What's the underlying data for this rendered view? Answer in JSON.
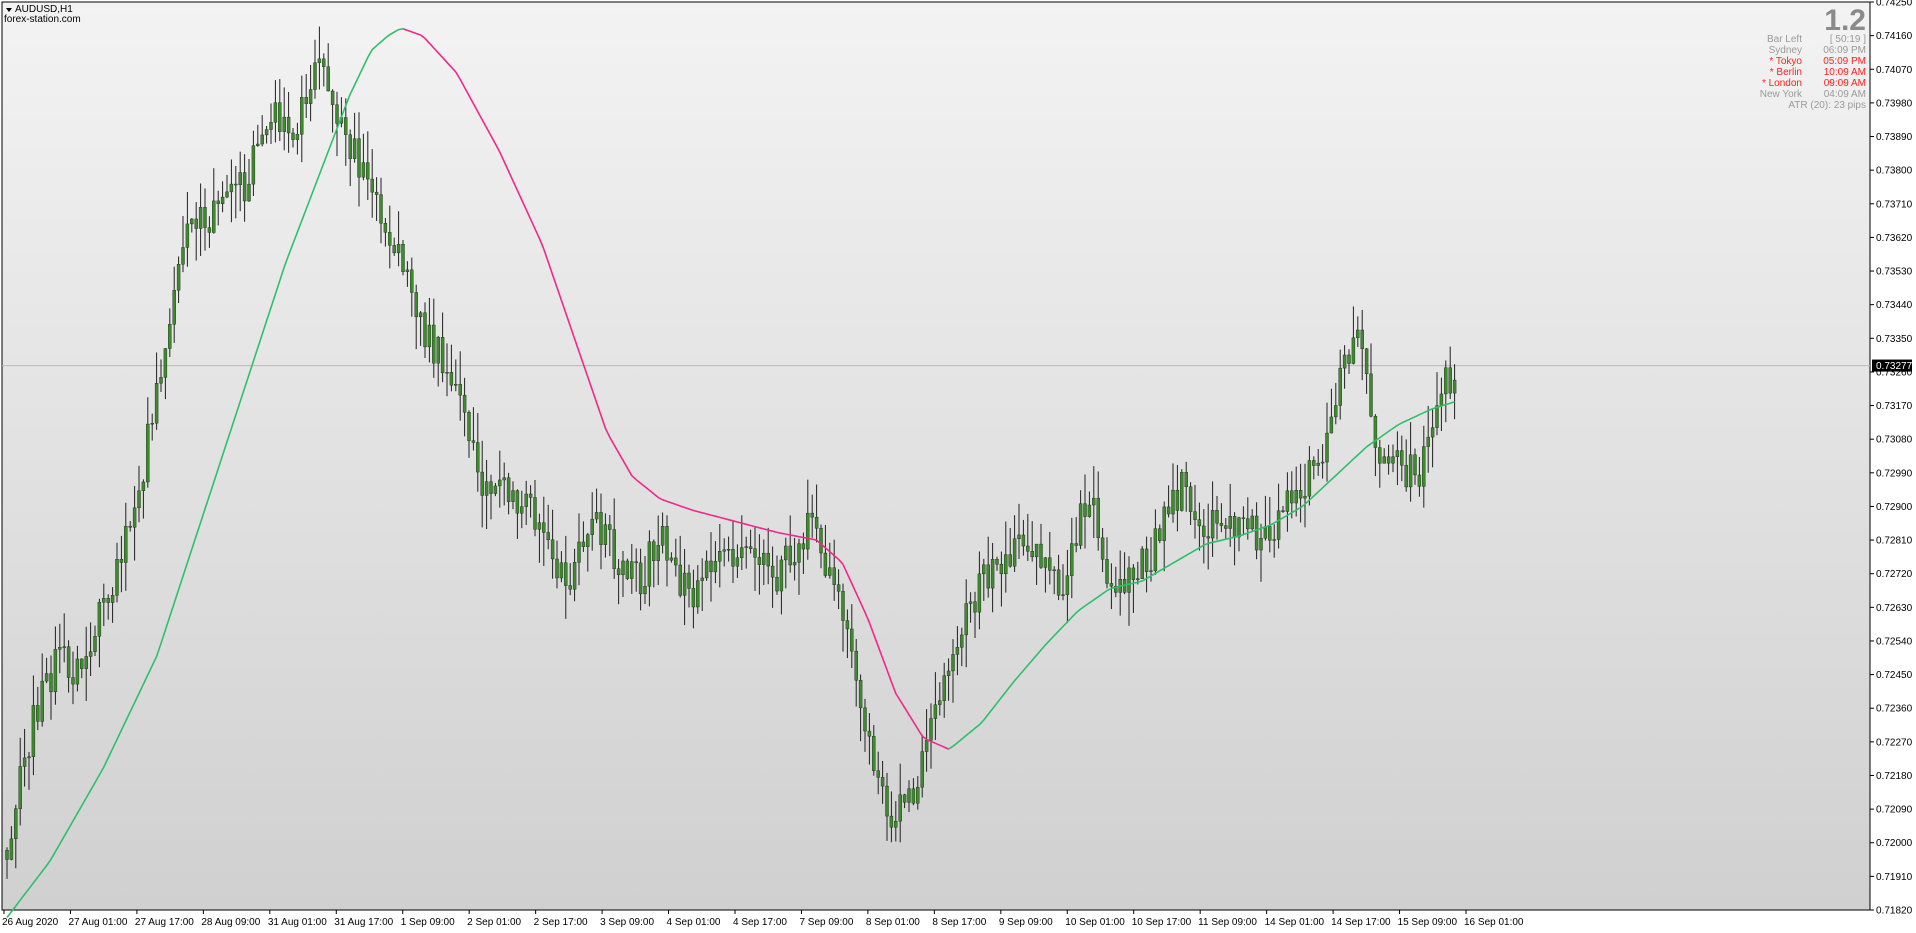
{
  "header": {
    "symbol_label": "AUDUSD,H1",
    "source_label": "forex-station.com",
    "big_value": "1.2"
  },
  "info_panel": [
    {
      "label": "Bar Left",
      "value": "[ 50:19 ]",
      "color": "#9a9a9a"
    },
    {
      "label": "Sydney",
      "value": "06:09 PM",
      "color": "#9a9a9a"
    },
    {
      "label": "* Tokyo",
      "value": "05:09 PM",
      "color": "#ff2020"
    },
    {
      "label": "* Berlin",
      "value": "10:09 AM",
      "color": "#ff2020"
    },
    {
      "label": "* London",
      "value": "09:09 AM",
      "color": "#ff2020"
    },
    {
      "label": "New York",
      "value": "04:09 AM",
      "color": "#9a9a9a"
    }
  ],
  "atr_text": "ATR (20): 23 pips",
  "colors": {
    "background_top": "#f3f3f3",
    "background_bottom": "#d0d0d0",
    "candle_body": "#3d8c2c",
    "candle_wick": "#202020",
    "ma_up": "#2fbf6a",
    "ma_down": "#f0288c",
    "price_tag_bg": "#000000",
    "current_price_line": "#b8b8b8"
  },
  "chart_data": {
    "type": "candlestick",
    "title": "AUDUSD,H1",
    "current_price": 0.73277,
    "current_price_label": "0.73277",
    "ylim": [
      0.7182,
      0.7425
    ],
    "y_ticks": [
      "0.74250",
      "0.74160",
      "0.74070",
      "0.73980",
      "0.73890",
      "0.73800",
      "0.73710",
      "0.73620",
      "0.73530",
      "0.73440",
      "0.73350",
      "0.73260",
      "0.73170",
      "0.73080",
      "0.72990",
      "0.72900",
      "0.72810",
      "0.72720",
      "0.72630",
      "0.72540",
      "0.72450",
      "0.72360",
      "0.72270",
      "0.72180",
      "0.72090",
      "0.72000",
      "0.71910",
      "0.71820"
    ],
    "x_tick_labels": [
      "26 Aug 2020",
      "27 Aug 01:00",
      "27 Aug 17:00",
      "28 Aug 09:00",
      "31 Aug 01:00",
      "31 Aug 17:00",
      "1 Sep 09:00",
      "2 Sep 01:00",
      "2 Sep 17:00",
      "3 Sep 09:00",
      "4 Sep 01:00",
      "4 Sep 17:00",
      "7 Sep 09:00",
      "8 Sep 01:00",
      "8 Sep 17:00",
      "9 Sep 09:00",
      "10 Sep 01:00",
      "10 Sep 17:00",
      "11 Sep 09:00",
      "14 Sep 01:00",
      "14 Sep 17:00",
      "15 Sep 09:00",
      "16 Sep 01:00"
    ],
    "bar_count": 330,
    "price_path": [
      [
        0,
        0.7198
      ],
      [
        12,
        0.7232
      ],
      [
        25,
        0.7252
      ],
      [
        32,
        0.7245
      ],
      [
        45,
        0.7262
      ],
      [
        60,
        0.729
      ],
      [
        70,
        0.732
      ],
      [
        82,
        0.736
      ],
      [
        98,
        0.737
      ],
      [
        110,
        0.7375
      ],
      [
        114,
        0.738
      ],
      [
        122,
        0.7396
      ],
      [
        132,
        0.7388
      ],
      [
        145,
        0.7408
      ],
      [
        165,
        0.738
      ],
      [
        180,
        0.7362
      ],
      [
        195,
        0.7336
      ],
      [
        210,
        0.7325
      ],
      [
        222,
        0.7295
      ],
      [
        235,
        0.7295
      ],
      [
        250,
        0.7285
      ],
      [
        262,
        0.7265
      ],
      [
        273,
        0.729
      ],
      [
        286,
        0.7273
      ],
      [
        297,
        0.727
      ],
      [
        305,
        0.7285
      ],
      [
        318,
        0.7265
      ],
      [
        332,
        0.7275
      ],
      [
        348,
        0.728
      ],
      [
        360,
        0.7272
      ],
      [
        375,
        0.7285
      ],
      [
        388,
        0.7265
      ],
      [
        400,
        0.7235
      ],
      [
        412,
        0.7205
      ],
      [
        425,
        0.7215
      ],
      [
        440,
        0.725
      ],
      [
        460,
        0.7275
      ],
      [
        478,
        0.728
      ],
      [
        492,
        0.7268
      ],
      [
        505,
        0.7293
      ],
      [
        516,
        0.7268
      ],
      [
        532,
        0.7275
      ],
      [
        548,
        0.7295
      ],
      [
        560,
        0.7285
      ],
      [
        575,
        0.7285
      ],
      [
        590,
        0.728
      ],
      [
        602,
        0.7295
      ],
      [
        614,
        0.7302
      ],
      [
        622,
        0.7325
      ],
      [
        630,
        0.7338
      ],
      [
        640,
        0.7305
      ],
      [
        650,
        0.73
      ],
      [
        660,
        0.7298
      ],
      [
        668,
        0.7318
      ],
      [
        676,
        0.7327
      ]
    ],
    "ma_path": [
      [
        0,
        0.718
      ],
      [
        20,
        0.7195
      ],
      [
        45,
        0.722
      ],
      [
        70,
        0.725
      ],
      [
        90,
        0.7285
      ],
      [
        110,
        0.732
      ],
      [
        130,
        0.7355
      ],
      [
        150,
        0.7385
      ],
      [
        160,
        0.74
      ],
      [
        170,
        0.7412
      ],
      [
        178,
        0.7416
      ],
      [
        184,
        0.7418
      ],
      [
        194,
        0.7416
      ],
      [
        210,
        0.7406
      ],
      [
        230,
        0.7385
      ],
      [
        250,
        0.736
      ],
      [
        265,
        0.7335
      ],
      [
        280,
        0.731
      ],
      [
        292,
        0.7298
      ],
      [
        305,
        0.7292
      ],
      [
        320,
        0.7289
      ],
      [
        340,
        0.7286
      ],
      [
        360,
        0.7283
      ],
      [
        378,
        0.7281
      ],
      [
        390,
        0.7275
      ],
      [
        402,
        0.726
      ],
      [
        415,
        0.724
      ],
      [
        428,
        0.7228
      ],
      [
        440,
        0.7225
      ],
      [
        455,
        0.7232
      ],
      [
        470,
        0.7243
      ],
      [
        485,
        0.7253
      ],
      [
        500,
        0.7262
      ],
      [
        515,
        0.7268
      ],
      [
        530,
        0.727
      ],
      [
        545,
        0.7275
      ],
      [
        560,
        0.728
      ],
      [
        575,
        0.7282
      ],
      [
        590,
        0.7285
      ],
      [
        605,
        0.729
      ],
      [
        620,
        0.7298
      ],
      [
        635,
        0.7306
      ],
      [
        650,
        0.7312
      ],
      [
        665,
        0.7316
      ],
      [
        676,
        0.7318
      ]
    ]
  }
}
